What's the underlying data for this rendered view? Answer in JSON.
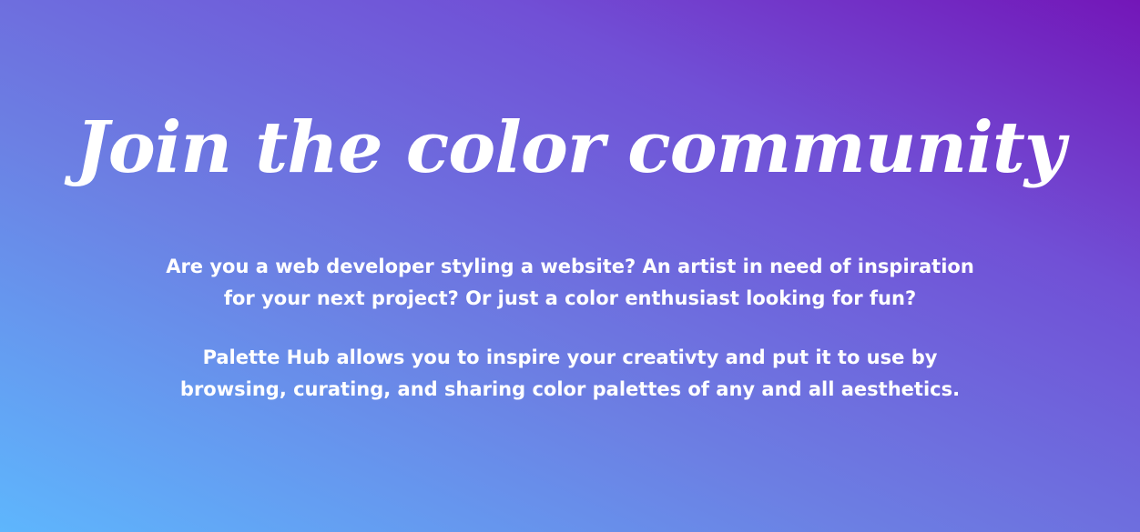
{
  "hero": {
    "title": "Join the color community",
    "paragraph_1": "Are you a web developer styling a website? An artist in need of inspiration for your next project? Or just a color enthusiast looking for fun?",
    "paragraph_2": "Palette Hub allows you to inspire your creativty and put it to use by browsing, curating, and sharing color palettes of any and all aesthetics."
  },
  "colors": {
    "gradient_start": "#5eb6fd",
    "gradient_mid": "#7150d6",
    "gradient_end": "#7316b8",
    "text": "#ffffff"
  }
}
